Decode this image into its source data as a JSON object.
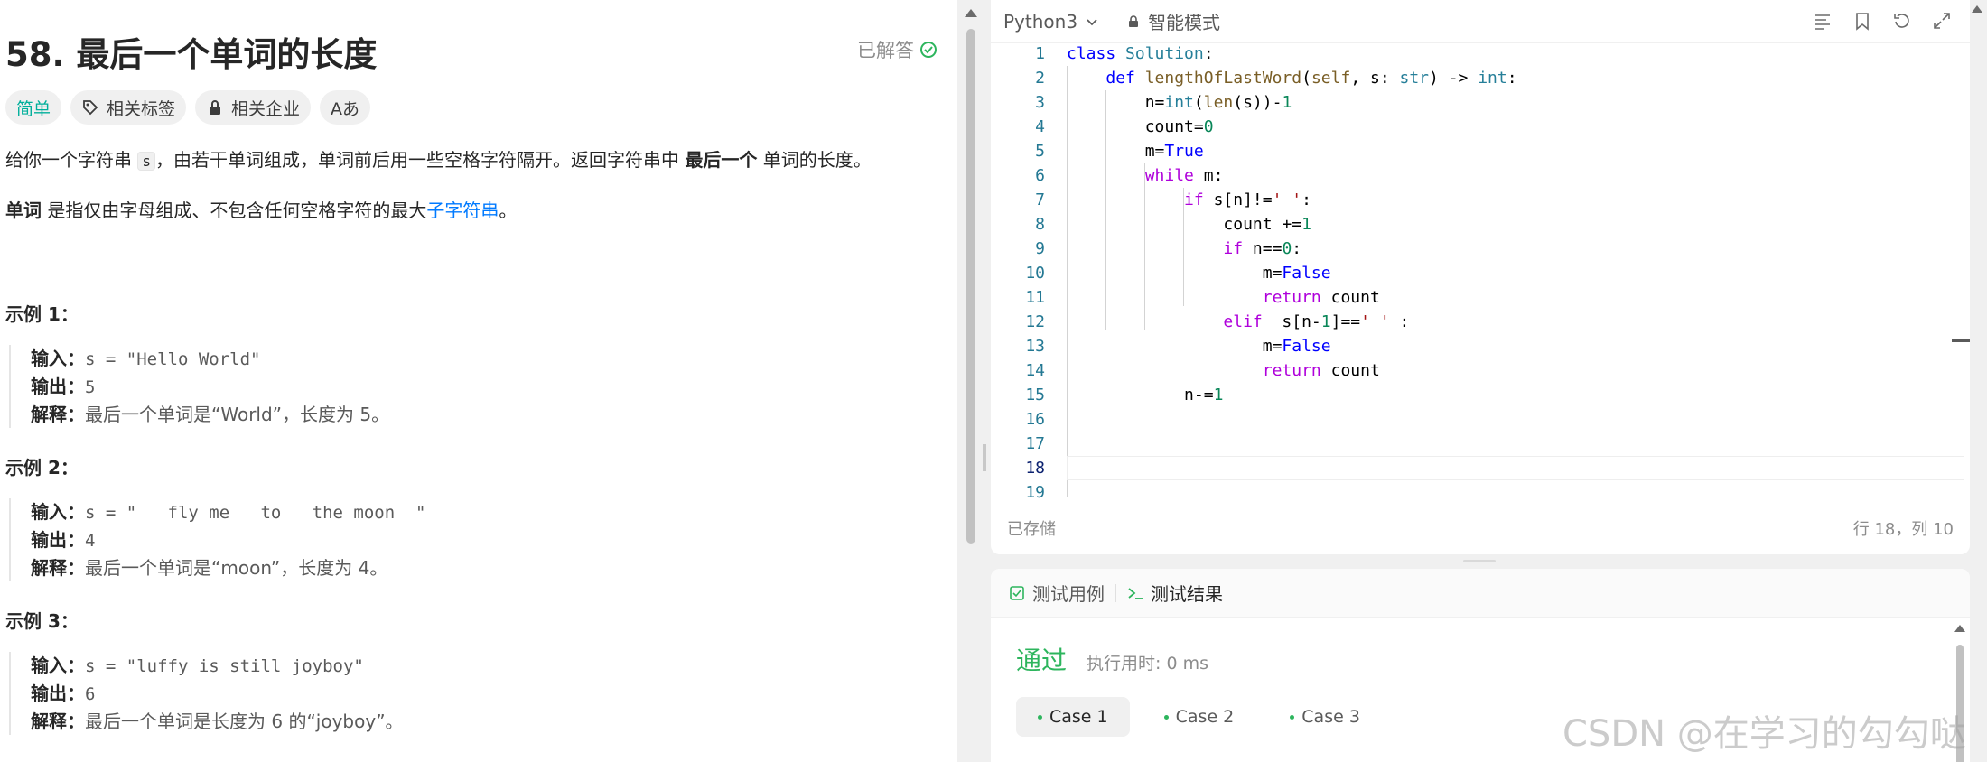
{
  "problem": {
    "title": "58. 最后一个单词的长度",
    "status": "已解答",
    "tags": {
      "difficulty": "简单",
      "topics": "相关标签",
      "companies": "相关企业",
      "font": "Aあ"
    },
    "desc1_a": "给你一个字符串 ",
    "desc1_code": "s",
    "desc1_b": "，由若干单词组成，单词前后用一些空格字符隔开。返回字符串中 ",
    "desc1_bold": "最后一个",
    "desc1_c": " 单词的长度。",
    "desc2_bold": "单词",
    "desc2_a": " 是指仅由字母组成、不包含任何空格字符的最大",
    "desc2_link": "子字符串",
    "desc2_b": "。",
    "examples": [
      {
        "title": "示例 1：",
        "input_label": "输入：",
        "input": "s = \"Hello World\"",
        "output_label": "输出：",
        "output": "5",
        "explain_label": "解释：",
        "explain": "最后一个单词是“World”，长度为 5。"
      },
      {
        "title": "示例 2：",
        "input_label": "输入：",
        "input": "s = \"   fly me   to   the moon  \"",
        "output_label": "输出：",
        "output": "4",
        "explain_label": "解释：",
        "explain": "最后一个单词是“moon”，长度为 4。"
      },
      {
        "title": "示例 3：",
        "input_label": "输入：",
        "input": "s = \"luffy is still joyboy\"",
        "output_label": "输出：",
        "output": "6",
        "explain_label": "解释：",
        "explain": "最后一个单词是长度为 6 的“joyboy”。"
      }
    ]
  },
  "editor": {
    "language": "Python3",
    "mode": "智能模式",
    "saved": "已存储",
    "cursor": "行 18，列 10",
    "tools": [
      "format-icon",
      "bookmark-icon",
      "reset-icon",
      "expand-icon"
    ],
    "line_numbers": [
      "1",
      "2",
      "3",
      "4",
      "5",
      "6",
      "7",
      "8",
      "9",
      "10",
      "11",
      "12",
      "13",
      "14",
      "15",
      "16",
      "17",
      "18",
      "19"
    ],
    "current_line": "18"
  },
  "test": {
    "tab_cases": "测试用例",
    "tab_result": "测试结果",
    "result": "通过",
    "runtime": "执行用时: 0 ms",
    "cases": [
      "Case 1",
      "Case 2",
      "Case 3"
    ]
  },
  "watermark": "CSDN @在学习的勾勾哒",
  "colors": {
    "easy": "#00af9b",
    "pass": "#2db55d",
    "link": "#007aff"
  }
}
